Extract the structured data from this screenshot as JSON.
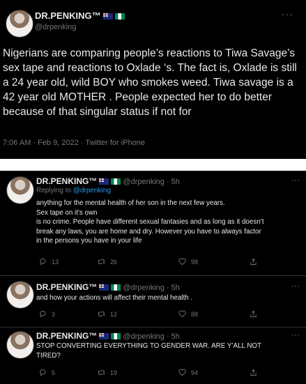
{
  "tweet_main": {
    "display_name": "DR.PENKING™",
    "handle": "@drpenking",
    "text": "Nigerians are comparing people’s reactions to Tiwa Savage’s sex tape and reactions to Oxlade ‘s. The fact is, Oxlade is still a 24 year old, wild BOY who smokes weed. Tiwa savage is a 42 year old MOTHER . People expected her to do better because of that singular status if not for",
    "meta": "7:06 AM · Feb 9, 2022 · Twitter for iPhone",
    "more_label": "···"
  },
  "replies": [
    {
      "display_name": "DR.PENKING™",
      "handle": "@drpenking",
      "time": "· 5h",
      "replying_prefix": "Replying to",
      "replying_handle": "@drpenking",
      "text_lines": [
        "anything for the mental health of her son in the next few years.",
        "Sex tape on it’s own",
        "is no crime. People have different sexual fantasies and as long as it doesn’t",
        "break any laws, you are home and dry. However you have to always factor",
        "in the persons you have in your life"
      ],
      "counts": {
        "reply": "13",
        "retweet": "26",
        "like": "98"
      }
    },
    {
      "display_name": "DR.PENKING™",
      "handle": "@drpenking",
      "time": "· 5h",
      "text_lines": [
        "and how your actions will affect their mental health ."
      ],
      "counts": {
        "reply": "3",
        "retweet": "12",
        "like": "88"
      }
    },
    {
      "display_name": "DR.PENKING™",
      "handle": "@drpenking",
      "time": "· 5h",
      "text_lines": [
        "STOP CONVERTING EVERYTHING TO GENDER WAR. ARE Y’ALL NOT",
        "TIRED?"
      ],
      "counts": {
        "reply": "5",
        "retweet": "19",
        "like": "94"
      }
    }
  ],
  "icons": [
    "avatar",
    "australia-flag-icon",
    "nigeria-flag-icon",
    "more-icon",
    "reply-icon",
    "retweet-icon",
    "like-icon",
    "share-icon"
  ],
  "colors": {
    "background": "#000000",
    "text": "#e7e9ea",
    "muted": "#71767b",
    "link": "#1d9bf0"
  }
}
